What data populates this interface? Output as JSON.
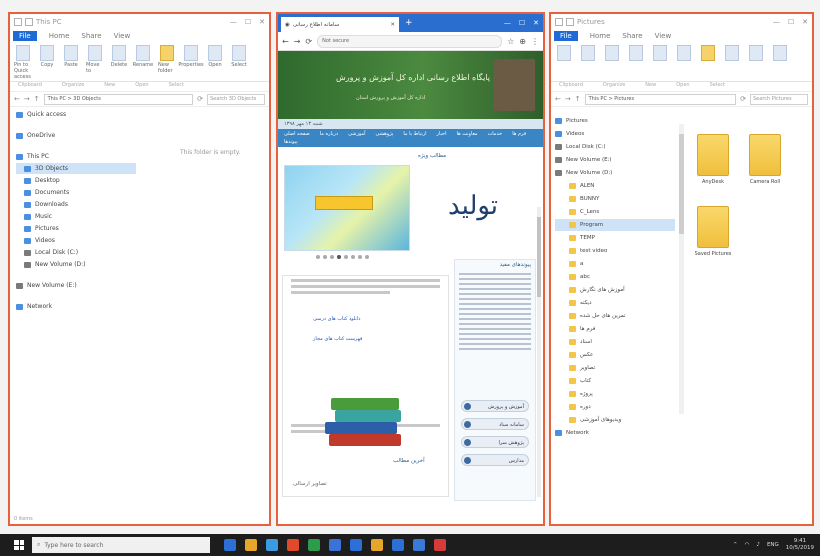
{
  "left_explorer": {
    "title": "This PC",
    "tabs": [
      "File",
      "Home",
      "Share",
      "View"
    ],
    "ribbon_buttons": [
      "Pin to Quick access",
      "Copy",
      "Paste",
      "Move to",
      "Delete",
      "Rename",
      "New folder",
      "Properties",
      "Open",
      "Select"
    ],
    "ribbon_groups": [
      "Clipboard",
      "Organize",
      "New",
      "Open",
      "Select"
    ],
    "address": "This PC > 3D Objects",
    "search_placeholder": "Search 3D Objects",
    "nav": [
      "Quick access",
      "OneDrive",
      "This PC",
      "3D Objects",
      "Desktop",
      "Documents",
      "Downloads",
      "Music",
      "Pictures",
      "Videos",
      "Local Disk (C:)",
      "New Volume (D:)",
      "New Volume (E:)",
      "Network"
    ],
    "empty_message": "This folder is empty.",
    "status": "0 items"
  },
  "browser": {
    "tab_title": "سامانه اطلاع رسانی",
    "url": "Not secure",
    "banner_title": "پایگاه اطلاع رسانی اداره کل آموزش و پرورش",
    "banner_subtitle": "اداره کل آموزش و پرورش استان",
    "info_line": "شنبه ۱۳ مهر ۱۳۹۸",
    "menu": [
      "صفحه اصلی",
      "درباره ما",
      "آموزشی",
      "پژوهشی",
      "ارتباط با ما",
      "اخبار",
      "معاونت ها",
      "خدمات",
      "فرم ها",
      "پیوندها"
    ],
    "logo": "تولید",
    "section_news": "مطالب ویژه",
    "section_links": "پیوندهای مفید",
    "section_last": "آخرین مطالب",
    "news_links": [
      "دانلود کتاب های درسی",
      "فهرست کتاب های مجاز"
    ],
    "side_pills": [
      "آموزش و پرورش",
      "سامانه سناد",
      "پژوهش سرا",
      "مدارس"
    ],
    "bottom_note": "تصاویر ارسالی"
  },
  "right_explorer": {
    "title": "Pictures",
    "tabs": [
      "File",
      "Home",
      "Share",
      "View"
    ],
    "ribbon_groups": [
      "Clipboard",
      "Organize",
      "New",
      "Open",
      "Select"
    ],
    "address": "This PC > Pictures",
    "search_placeholder": "Search Pictures",
    "nav": [
      "Pictures",
      "Videos",
      "Local Disk (C:)",
      "New Volume (E:)",
      "New Volume (D:)",
      "ALEN",
      "BUNNY",
      "C_Lens",
      "Program",
      "TEMP",
      "test video",
      "a",
      "abc",
      "آموزش های نگارش",
      "دیکته",
      "تمرین های حل شده",
      "فرم ها",
      "اسناد",
      "عکس",
      "تصاویر",
      "کتاب",
      "پروژه",
      "دوره",
      "ویدیوهای آموزشی",
      "Network"
    ],
    "folders": [
      "AnyDesk",
      "Camera Roll",
      "Saved Pictures"
    ]
  },
  "taskbar": {
    "search_placeholder": "Type here to search",
    "tray_text": "ENG",
    "clock_time": "9:41",
    "clock_date": "10/5/2019",
    "app_colors": [
      "#2c6fd6",
      "#e5a62a",
      "#3a9be0",
      "#e04a2a",
      "#2c9c4a",
      "#3a73d8",
      "#2c6fd6",
      "#e5a62a",
      "#2c6fd6",
      "#3a7ad6",
      "#d63a3a"
    ]
  }
}
